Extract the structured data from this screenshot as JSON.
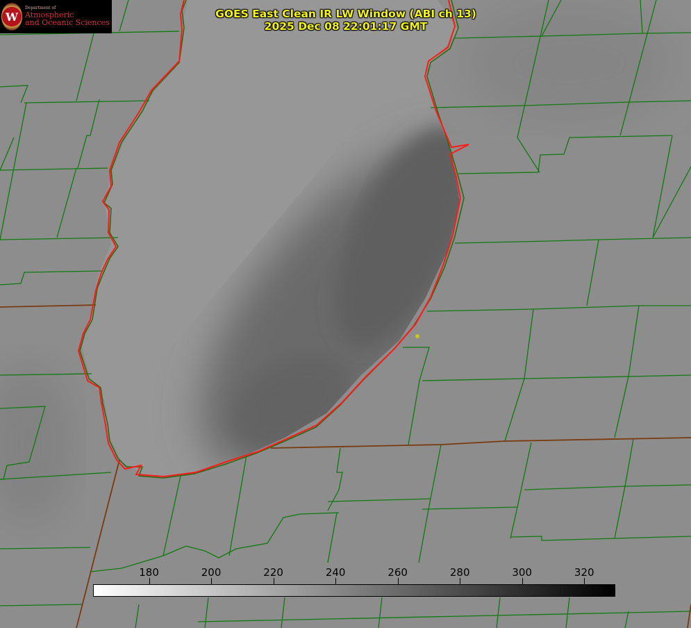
{
  "logo": {
    "seal_letter": "W",
    "department": "Department of",
    "line1": "Atmospheric",
    "line2": "and Oceanic Sciences"
  },
  "title": {
    "line1": "GOES East Clean IR LW Window (ABI ch 13)",
    "line2": "2025 Dec 08 22:01:17 GMT"
  },
  "colorbar": {
    "min": 162,
    "max": 330,
    "ticks": [
      "180",
      "200",
      "220",
      "240",
      "260",
      "280",
      "300",
      "320"
    ]
  },
  "colors": {
    "land": "#8d8d8d",
    "lake": "#979797",
    "cold_band": "#6a6a6a",
    "county_lines": "#0f7a0f",
    "state_lines": "#7a3a10",
    "coastline": "#ff1a1a",
    "title_text": "#f2f21a",
    "marker": "#c8c81a"
  }
}
